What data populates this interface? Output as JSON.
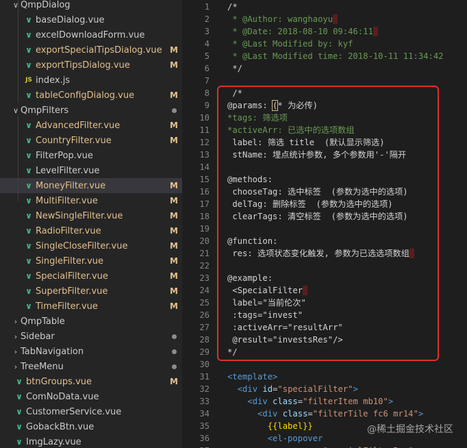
{
  "explorer": {
    "items": [
      {
        "label": "QmpDialog",
        "kind": "folder",
        "open": true,
        "indent": 1,
        "status": ""
      },
      {
        "label": "baseDialog.vue",
        "kind": "vue",
        "indent": 2,
        "status": ""
      },
      {
        "label": "excelDownloadForm.vue",
        "kind": "vue",
        "indent": 2,
        "status": ""
      },
      {
        "label": "exportSpecialTipsDialog.vue",
        "kind": "vue",
        "indent": 2,
        "status": "M"
      },
      {
        "label": "exportTipsDialog.vue",
        "kind": "vue",
        "indent": 2,
        "status": "M"
      },
      {
        "label": "index.js",
        "kind": "js",
        "indent": 2,
        "status": ""
      },
      {
        "label": "tableConfigDialog.vue",
        "kind": "vue",
        "indent": 2,
        "status": "M"
      },
      {
        "label": "QmpFilters",
        "kind": "folder",
        "open": true,
        "indent": 1,
        "status": "dot"
      },
      {
        "label": "AdvancedFilter.vue",
        "kind": "vue",
        "indent": 2,
        "status": "M"
      },
      {
        "label": "CountryFilter.vue",
        "kind": "vue",
        "indent": 2,
        "status": "M"
      },
      {
        "label": "FilterPop.vue",
        "kind": "vue",
        "indent": 2,
        "status": ""
      },
      {
        "label": "LevelFilter.vue",
        "kind": "vue",
        "indent": 2,
        "status": ""
      },
      {
        "label": "MoneyFilter.vue",
        "kind": "vue",
        "indent": 2,
        "status": "M",
        "selected": true
      },
      {
        "label": "MultiFilter.vue",
        "kind": "vue",
        "indent": 2,
        "status": "M"
      },
      {
        "label": "NewSingleFilter.vue",
        "kind": "vue",
        "indent": 2,
        "status": "M"
      },
      {
        "label": "RadioFilter.vue",
        "kind": "vue",
        "indent": 2,
        "status": "M"
      },
      {
        "label": "SingleCloseFilter.vue",
        "kind": "vue",
        "indent": 2,
        "status": "M"
      },
      {
        "label": "SingleFilter.vue",
        "kind": "vue",
        "indent": 2,
        "status": "M"
      },
      {
        "label": "SpecialFilter.vue",
        "kind": "vue",
        "indent": 2,
        "status": "M"
      },
      {
        "label": "SuperbFilter.vue",
        "kind": "vue",
        "indent": 2,
        "status": "M"
      },
      {
        "label": "TimeFilter.vue",
        "kind": "vue",
        "indent": 2,
        "status": "M"
      },
      {
        "label": "QmpTable",
        "kind": "folder",
        "open": false,
        "indent": 1,
        "status": ""
      },
      {
        "label": "Sidebar",
        "kind": "folder",
        "open": false,
        "indent": 1,
        "status": "dot"
      },
      {
        "label": "TabNavigation",
        "kind": "folder",
        "open": false,
        "indent": 1,
        "status": "dot"
      },
      {
        "label": "TreeMenu",
        "kind": "folder",
        "open": false,
        "indent": 1,
        "status": "dot"
      },
      {
        "label": "btnGroups.vue",
        "kind": "vue",
        "indent": 1,
        "status": "M"
      },
      {
        "label": "ComNoData.vue",
        "kind": "vue",
        "indent": 1,
        "status": ""
      },
      {
        "label": "CustomerService.vue",
        "kind": "vue",
        "indent": 1,
        "status": ""
      },
      {
        "label": "GobackBtn.vue",
        "kind": "vue",
        "indent": 1,
        "status": ""
      },
      {
        "label": "ImgLazy.vue",
        "kind": "vue",
        "indent": 1,
        "status": ""
      }
    ]
  },
  "editor": {
    "lines": [
      {
        "n": "1",
        "segs": [
          [
            "cmw",
            "/*"
          ]
        ]
      },
      {
        "n": "2",
        "segs": [
          [
            "cm",
            " * @Author: wanghaoyu"
          ],
          [
            "sel",
            " "
          ]
        ]
      },
      {
        "n": "3",
        "segs": [
          [
            "cm",
            " * @Date: 2018-08-10 09:46:11"
          ],
          [
            "sel",
            " "
          ]
        ]
      },
      {
        "n": "4",
        "segs": [
          [
            "cm",
            " * @Last Modified by: kyf"
          ]
        ]
      },
      {
        "n": "5",
        "segs": [
          [
            "cm",
            " * @Last Modified time: 2018-10-11 11:34:42"
          ]
        ]
      },
      {
        "n": "6",
        "segs": [
          [
            "cmw",
            " */"
          ]
        ]
      },
      {
        "n": "7",
        "segs": []
      },
      {
        "n": "8",
        "segs": [
          [
            "cmw",
            " /*"
          ]
        ]
      },
      {
        "n": "9",
        "segs": [
          [
            "cmw",
            "@params: "
          ],
          [
            "hl",
            "("
          ],
          [
            "cmw",
            "* 为必传)"
          ]
        ]
      },
      {
        "n": "10",
        "segs": [
          [
            "cm",
            "*tags: 筛选项"
          ]
        ]
      },
      {
        "n": "11",
        "segs": [
          [
            "cm",
            "*activeArr: 已选中的选项数组"
          ]
        ]
      },
      {
        "n": "12",
        "segs": [
          [
            "cmw",
            " label: 筛选 title  (默认显示筛选)"
          ]
        ]
      },
      {
        "n": "13",
        "segs": [
          [
            "cmw",
            " stName: 埋点统计参数, 多个参数用'-'隔开"
          ]
        ]
      },
      {
        "n": "14",
        "segs": []
      },
      {
        "n": "15",
        "segs": [
          [
            "cmw",
            "@methods:"
          ]
        ]
      },
      {
        "n": "16",
        "segs": [
          [
            "cmw",
            " chooseTag: 选中标签  (参数为选中的选项)"
          ]
        ]
      },
      {
        "n": "17",
        "segs": [
          [
            "cmw",
            " delTag: 删除标签  (参数为选中的选项)"
          ]
        ]
      },
      {
        "n": "18",
        "segs": [
          [
            "cmw",
            " clearTags: 清空标签  (参数为选中的选项)"
          ]
        ]
      },
      {
        "n": "19",
        "segs": []
      },
      {
        "n": "20",
        "segs": [
          [
            "cmw",
            "@function:"
          ]
        ]
      },
      {
        "n": "21",
        "segs": [
          [
            "cmw",
            " res: 选项状态变化触发, 参数为已选选项数组"
          ],
          [
            "sel",
            " "
          ]
        ]
      },
      {
        "n": "22",
        "segs": []
      },
      {
        "n": "23",
        "segs": [
          [
            "cmw",
            "@example:"
          ]
        ]
      },
      {
        "n": "24",
        "segs": [
          [
            "cmw",
            " <SpecialFilter"
          ],
          [
            "sel",
            " "
          ]
        ]
      },
      {
        "n": "25",
        "segs": [
          [
            "cmw",
            " label=\"当前伦次\""
          ]
        ]
      },
      {
        "n": "26",
        "segs": [
          [
            "cmw",
            " :tags=\"invest\""
          ]
        ]
      },
      {
        "n": "27",
        "segs": [
          [
            "cmw",
            " :activeArr=\"resultArr\""
          ]
        ]
      },
      {
        "n": "28",
        "segs": [
          [
            "cmw",
            " @result=\"investsRes\"/>"
          ]
        ]
      },
      {
        "n": "29",
        "segs": [
          [
            "cmw",
            "*/"
          ]
        ]
      },
      {
        "n": "30",
        "segs": []
      },
      {
        "n": "31",
        "segs": [
          [
            "tag",
            "<template>"
          ]
        ]
      },
      {
        "n": "32",
        "segs": [
          [
            "code",
            "  "
          ],
          [
            "tag",
            "<div "
          ],
          [
            "attr",
            "id"
          ],
          [
            "code",
            "="
          ],
          [
            "str",
            "\"specialFilter\""
          ],
          [
            "tag",
            ">"
          ]
        ]
      },
      {
        "n": "33",
        "segs": [
          [
            "code",
            "    "
          ],
          [
            "tag",
            "<div "
          ],
          [
            "attr",
            "class"
          ],
          [
            "code",
            "="
          ],
          [
            "str",
            "\"filterItem mb10\""
          ],
          [
            "tag",
            ">"
          ]
        ]
      },
      {
        "n": "34",
        "segs": [
          [
            "code",
            "      "
          ],
          [
            "tag",
            "<div "
          ],
          [
            "attr",
            "class"
          ],
          [
            "code",
            "="
          ],
          [
            "str",
            "\"filterTile fc6 mr14\""
          ],
          [
            "tag",
            ">"
          ]
        ]
      },
      {
        "n": "35",
        "segs": [
          [
            "code",
            "        "
          ],
          [
            "brace",
            "{{label}}"
          ]
        ]
      },
      {
        "n": "36",
        "segs": [
          [
            "code",
            "        "
          ],
          [
            "tag",
            "<el-popover"
          ]
        ]
      },
      {
        "n": "37",
        "segs": [
          [
            "code",
            "          "
          ],
          [
            "attr",
            "........"
          ],
          [
            "code",
            "="
          ],
          [
            "str",
            "\"specialFilterPop\""
          ]
        ]
      }
    ]
  },
  "watermark": "@稀土掘金技术社区"
}
